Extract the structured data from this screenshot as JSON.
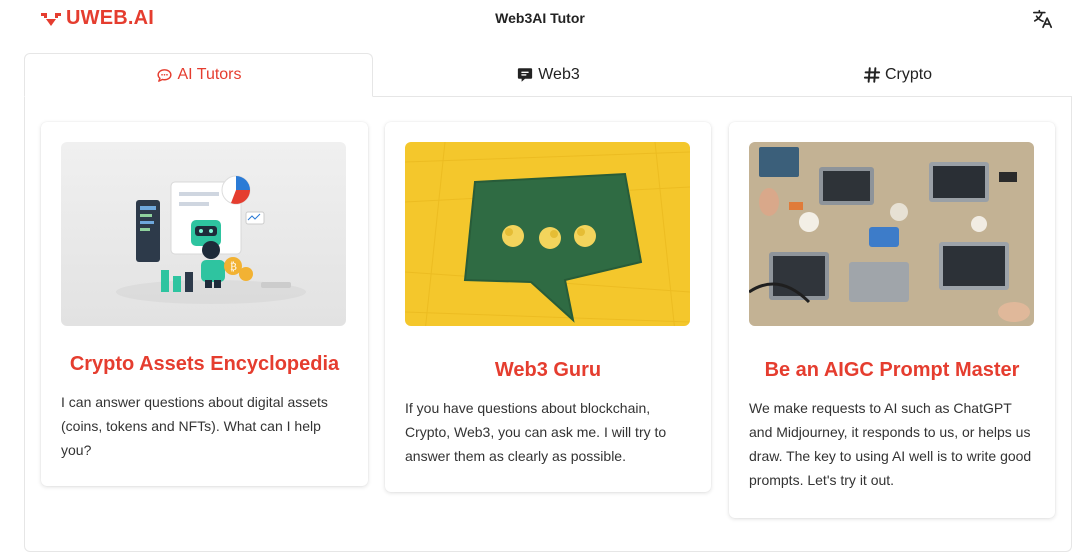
{
  "header": {
    "logo_text": "UWEB.AI",
    "app_title": "Web3AI Tutor",
    "translate_icon": "translate-icon"
  },
  "tabs": [
    {
      "label": "AI Tutors",
      "icon": "chat-bubble-icon",
      "active": true
    },
    {
      "label": "Web3",
      "icon": "message-square-icon",
      "active": false
    },
    {
      "label": "Crypto",
      "icon": "hashtag-icon",
      "active": false
    }
  ],
  "cards": [
    {
      "title": "Crypto Assets Encyclopedia",
      "description": "I can answer questions about digital assets (coins, tokens and NFTs). What can I help you?",
      "image": "robot-crypto-illustration"
    },
    {
      "title": "Web3 Guru",
      "description": "If you have questions about blockchain, Crypto, Web3, you can ask me. I will try to answer them as clearly as possible.",
      "image": "speech-bubble-paper-photo"
    },
    {
      "title": "Be an AIGC Prompt Master",
      "description": "We make requests to AI such as ChatGPT and Midjourney, it responds to us, or helps us draw. The key to using AI well is to write good prompts. Let's try it out.",
      "image": "team-laptops-desk-photo"
    }
  ],
  "colors": {
    "brand": "#e53d2f",
    "text": "#222222",
    "border": "#e6e6e6"
  }
}
